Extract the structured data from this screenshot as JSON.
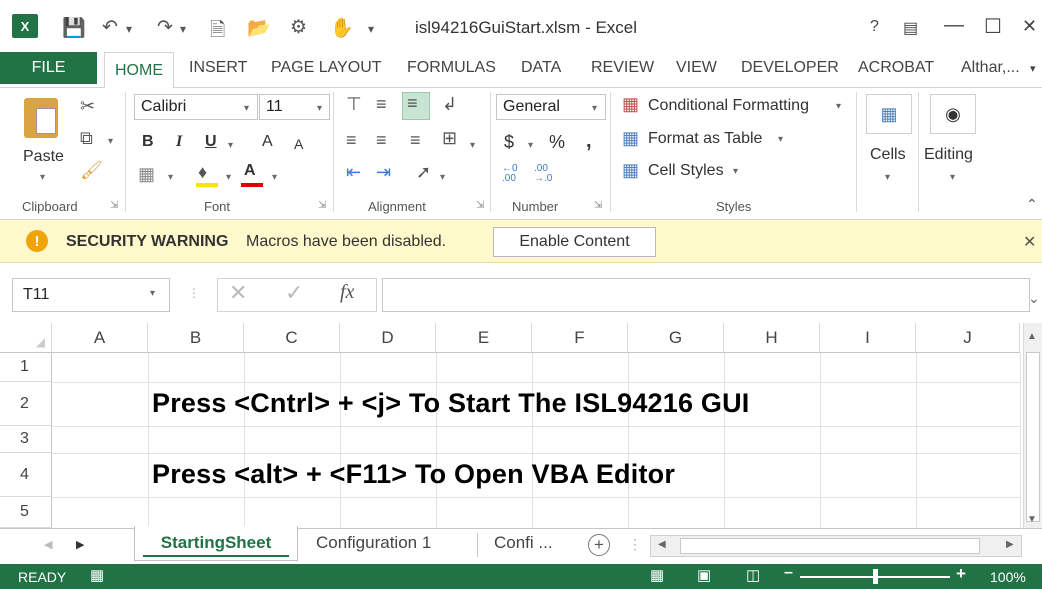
{
  "window": {
    "title": "isl94216GuiStart.xlsm - Excel",
    "help": "?",
    "minimize": "—",
    "maximize": "☐",
    "close": "✕"
  },
  "tabs": {
    "file": "FILE",
    "home": "HOME",
    "items": [
      "INSERT",
      "PAGE LAYOUT",
      "FORMULAS",
      "DATA",
      "REVIEW",
      "VIEW",
      "DEVELOPER",
      "ACROBAT"
    ],
    "user": "Althar,..."
  },
  "ribbon": {
    "clipboard": {
      "paste": "Paste",
      "label": "Clipboard"
    },
    "font": {
      "name": "Calibri",
      "size": "11",
      "bold": "B",
      "italic": "I",
      "underline": "U",
      "grow": "A",
      "shrink": "A",
      "label": "Font"
    },
    "alignment": {
      "label": "Alignment"
    },
    "number": {
      "format": "General",
      "currency": "$",
      "percent": "%",
      "comma": ",",
      "label": "Number"
    },
    "styles": {
      "conditional": "Conditional Formatting",
      "table": "Format as Table",
      "cell": "Cell Styles",
      "label": "Styles"
    },
    "cells": {
      "label": "Cells"
    },
    "editing": {
      "label": "Editing"
    }
  },
  "security": {
    "title": "SECURITY WARNING",
    "message": "Macros have been disabled.",
    "button": "Enable Content"
  },
  "formula_bar": {
    "name_box": "T11",
    "fx": "fx",
    "value": ""
  },
  "grid": {
    "columns": [
      "A",
      "B",
      "C",
      "D",
      "E",
      "F",
      "G",
      "H",
      "I",
      "J"
    ],
    "rows": [
      "1",
      "2",
      "3",
      "4",
      "5"
    ],
    "cells": {
      "B2": "Press <Cntrl> + <j>  To Start The ISL94216 GUI",
      "B4": "Press <alt> + <F11>  To Open VBA Editor"
    }
  },
  "sheets": {
    "active": "StartingSheet",
    "others": [
      "Configuration 1",
      "Confi ..."
    ]
  },
  "status": {
    "ready": "READY",
    "zoom": "100%",
    "zoom_level": 1.0
  }
}
